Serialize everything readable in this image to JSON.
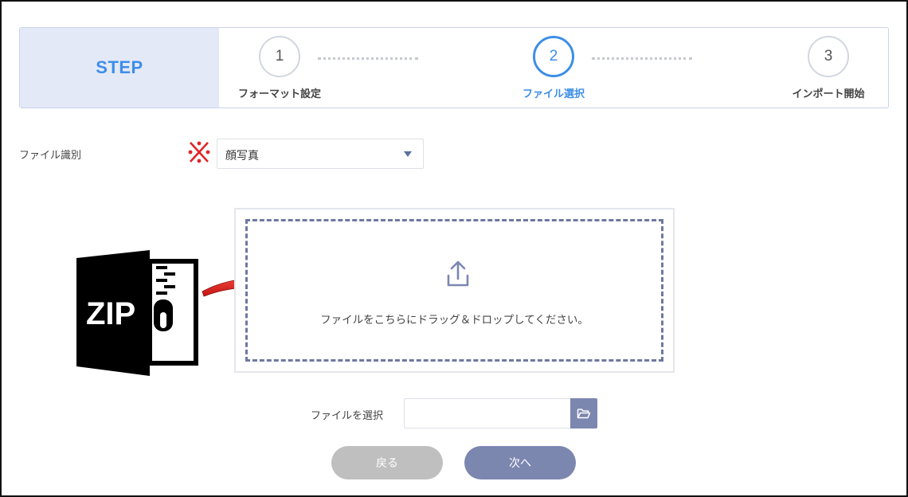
{
  "stepbar": {
    "title": "STEP",
    "steps": [
      {
        "number": "1",
        "label": "フォーマット設定",
        "active": false
      },
      {
        "number": "2",
        "label": "ファイル選択",
        "active": true
      },
      {
        "number": "3",
        "label": "インポート開始",
        "active": false
      }
    ]
  },
  "form": {
    "file_type_label": "ファイル識別",
    "file_type_value": "顔写真",
    "required_icon": "required-asterisk-icon",
    "choose_file_label": "ファイルを選択",
    "file_input_value": ""
  },
  "dropzone": {
    "text": "ファイルをこちらにドラッグ＆ドロップしてください。",
    "icon": "upload-icon"
  },
  "annotation": {
    "zip_label": "ZIP",
    "icons": [
      "zip-file-icon",
      "red-arrow-icon"
    ]
  },
  "buttons": {
    "back_label": "戻る",
    "next_label": "次へ"
  },
  "colors": {
    "accent": "#3d8ee8",
    "primary_button": "#7c87b0",
    "disabled_button": "#bfbfbf",
    "step_header_bg": "#e4e9f8",
    "required_red": "#e0262a"
  }
}
